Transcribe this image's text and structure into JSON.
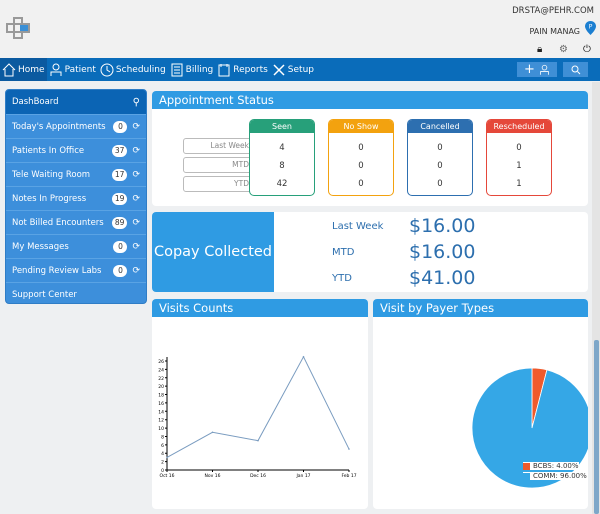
{
  "header": {
    "email": "DRSTA@PEHR.COM",
    "clinic": "PAIN MANAG",
    "icons": [
      "lock-icon",
      "gear-icon",
      "power-icon"
    ]
  },
  "nav": {
    "items": [
      {
        "label": "Home",
        "icon": "home-icon"
      },
      {
        "label": "Patient",
        "icon": "patient-icon"
      },
      {
        "label": "Scheduling",
        "icon": "clock-icon"
      },
      {
        "label": "Billing",
        "icon": "billing-icon"
      },
      {
        "label": "Reports",
        "icon": "calendar-icon"
      },
      {
        "label": "Setup",
        "icon": "tools-icon"
      }
    ],
    "add_patient": "+"
  },
  "sidebar": {
    "title": "DashBoard",
    "items": [
      {
        "label": "Today's Appointments",
        "count": "0"
      },
      {
        "label": "Patients In Office",
        "count": "37"
      },
      {
        "label": "Tele Waiting Room",
        "count": "17"
      },
      {
        "label": "Notes In Progress",
        "count": "19"
      },
      {
        "label": "Not Billed Encounters",
        "count": "89"
      },
      {
        "label": "My Messages",
        "count": "0"
      },
      {
        "label": "Pending Review Labs",
        "count": "0"
      },
      {
        "label": "Support Center"
      }
    ]
  },
  "appointment_status": {
    "title": "Appointment Status",
    "rows": [
      "Last Week",
      "MTD",
      "YTD"
    ],
    "cards": [
      {
        "label": "Seen",
        "color": "#27a07a",
        "values": [
          "4",
          "8",
          "42"
        ]
      },
      {
        "label": "No Show",
        "color": "#f3a20f",
        "values": [
          "0",
          "0",
          "0"
        ]
      },
      {
        "label": "Cancelled",
        "color": "#2d6fb0",
        "values": [
          "0",
          "0",
          "0"
        ]
      },
      {
        "label": "Rescheduled",
        "color": "#e5483a",
        "values": [
          "0",
          "1",
          "1"
        ]
      }
    ]
  },
  "copay": {
    "title": "Copay Collected",
    "rows": [
      {
        "label": "Last Week",
        "value": "$16.00"
      },
      {
        "label": "MTD",
        "value": "$16.00"
      },
      {
        "label": "YTD",
        "value": "$41.00"
      }
    ]
  },
  "visits": {
    "title": "Visits Counts"
  },
  "payer": {
    "title": "Visit by Payer Types"
  },
  "chart_data": [
    {
      "type": "line",
      "categories": [
        "Oct 16",
        "Nov 16",
        "Dec 16",
        "Jan 17",
        "Feb 17"
      ],
      "values": [
        3,
        9,
        7,
        27,
        5
      ],
      "ylim": [
        0,
        27
      ],
      "yticks": [
        0,
        2,
        4,
        6,
        8,
        10,
        12,
        14,
        16,
        18,
        20,
        22,
        24,
        26
      ],
      "color": "#7a9cc0"
    },
    {
      "type": "pie",
      "labels": [
        "BCBS",
        "COMM"
      ],
      "values": [
        4,
        96
      ],
      "legend_text": [
        "BCBS: 4.00%",
        "COMM: 96.00%"
      ],
      "colors": [
        "#ef5a2c",
        "#35a7e6"
      ],
      "legend": "bottom-right"
    }
  ]
}
